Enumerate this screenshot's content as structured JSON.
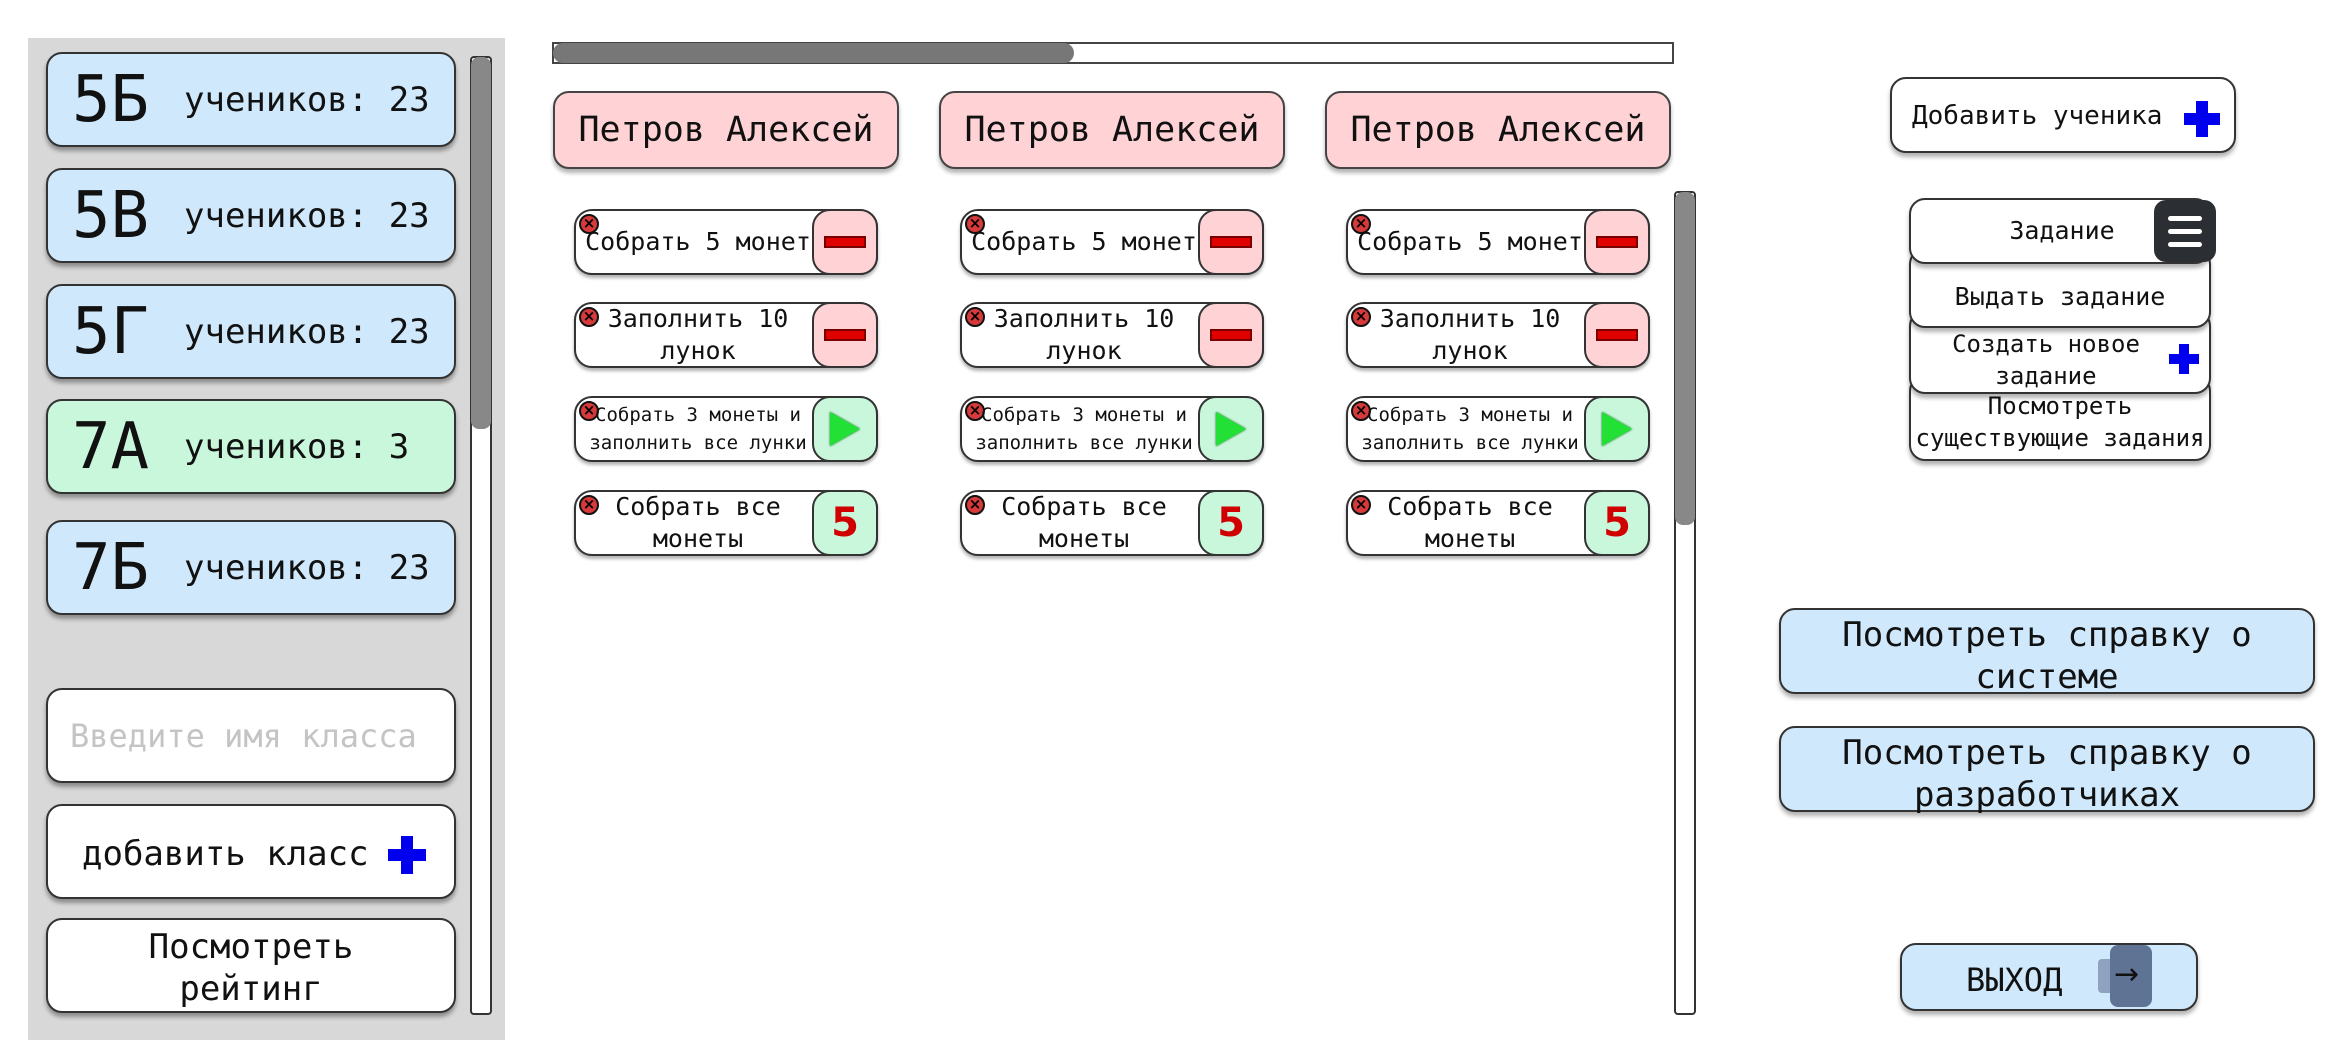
{
  "sidebar": {
    "classes": [
      {
        "name": "5Б",
        "count_label": "учеников: 23",
        "color": "#cfe8fb"
      },
      {
        "name": "5В",
        "count_label": "учеников: 23",
        "color": "#cfe8fb"
      },
      {
        "name": "5Г",
        "count_label": "учеников: 23",
        "color": "#cfe8fb"
      },
      {
        "name": "7А",
        "count_label": "учеников: 3",
        "color": "#c9f7dc"
      },
      {
        "name": "7Б",
        "count_label": "учеников: 23",
        "color": "#cfe8fb"
      }
    ],
    "class_input_placeholder": "Введите имя класса",
    "add_class_label": "добавить класс",
    "view_rating_label": "Посмотреть\nрейтинг"
  },
  "progress": {
    "fraction": 0.465
  },
  "students": [
    {
      "name": "Петров Алексей",
      "tasks": [
        {
          "label": "Собрать 5 монет",
          "action": "minus"
        },
        {
          "label": "Заполнить 10 лунок",
          "action": "minus"
        },
        {
          "label": "Собрать 3 монеты и заполнить все лунки",
          "action": "play"
        },
        {
          "label": "Собрать все монеты",
          "action": "score",
          "score": "5"
        }
      ]
    },
    {
      "name": "Петров Алексей",
      "tasks": [
        {
          "label": "Собрать 5 монет",
          "action": "minus"
        },
        {
          "label": "Заполнить 10 лунок",
          "action": "minus"
        },
        {
          "label": "Собрать 3 монеты и заполнить все лунки",
          "action": "play"
        },
        {
          "label": "Собрать все монеты",
          "action": "score",
          "score": "5"
        }
      ]
    },
    {
      "name": "Петров Алексей",
      "tasks": [
        {
          "label": "Собрать 5 монет",
          "action": "minus"
        },
        {
          "label": "Заполнить 10 лунок",
          "action": "minus"
        },
        {
          "label": "Собрать 3 монеты и заполнить все лунки",
          "action": "play"
        },
        {
          "label": "Собрать все монеты",
          "action": "score",
          "score": "5"
        }
      ]
    }
  ],
  "right_panel": {
    "add_student_label": "Добавить ученика",
    "task_menu": {
      "title": "Задание",
      "items": [
        "Выдать задание",
        "Создать новое задание",
        "Посмотреть существующие задания"
      ]
    },
    "help_system_label": "Посмотреть справку о системе",
    "help_devs_label": "Посмотреть справку о разработчиках",
    "exit_label": "ВЫХОД"
  },
  "icons": {
    "plus": "plus-icon",
    "menu": "hamburger-menu-icon",
    "exit": "exit-arrow-icon",
    "delete": "close-x-icon",
    "minus": "minus-icon",
    "play": "play-icon"
  },
  "colors": {
    "class_blue": "#cfe8fb",
    "class_green": "#c9f7dc",
    "student_header": "#ffd3d5",
    "plus": "#0000ee",
    "score_red": "#d00000"
  }
}
